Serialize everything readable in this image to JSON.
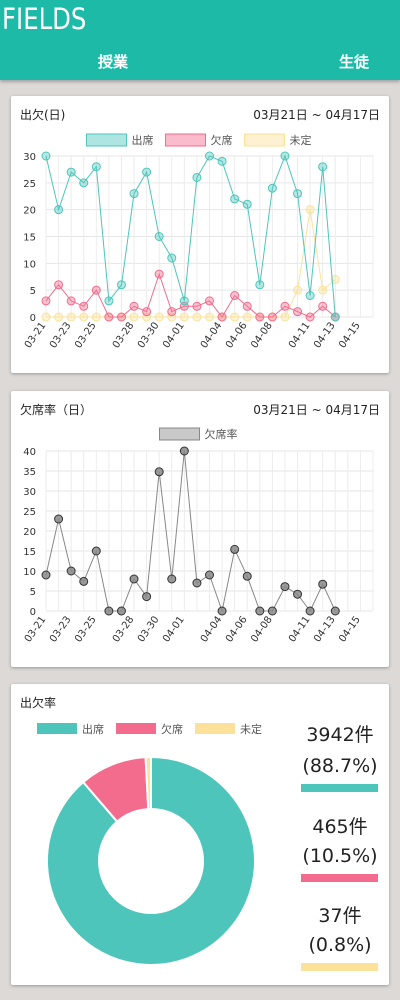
{
  "header": {
    "app_title": "FIELDS",
    "tabs": [
      "授業",
      "生徒"
    ]
  },
  "colors": {
    "header": "#1dbaa7",
    "present": "#4ec5bb",
    "absent": "#f36b8d",
    "undecided": "#fbe19a",
    "rate": "#888888"
  },
  "attendance_card": {
    "title": "出欠(日)",
    "date_range": "03月21日 ~ 04月17日"
  },
  "rate_card": {
    "title": "欠席率（日）",
    "date_range": "03月21日 ~ 04月17日"
  },
  "summary_card": {
    "title": "出欠率",
    "stats": [
      {
        "count": "3942件",
        "percent": "(88.7%)"
      },
      {
        "count": "465件",
        "percent": "(10.5%)"
      },
      {
        "count": "37件",
        "percent": "(0.8%)"
      }
    ]
  },
  "chart_data": [
    {
      "type": "line",
      "title": "",
      "x": [
        "03-21",
        "03-22",
        "03-23",
        "03-24",
        "03-25",
        "03-26",
        "03-27",
        "03-28",
        "03-29",
        "03-30",
        "03-31",
        "04-01",
        "04-02",
        "04-03",
        "04-04",
        "04-05",
        "04-06",
        "04-07",
        "04-08",
        "04-09",
        "04-10",
        "04-11",
        "04-12",
        "04-13",
        "04-14",
        "04-15",
        "04-16"
      ],
      "xticks": [
        "03-21",
        "03-23",
        "03-25",
        "03-28",
        "03-30",
        "04-01",
        "04-04",
        "04-06",
        "04-08",
        "04-11",
        "04-13",
        "04-15"
      ],
      "ylim": [
        0,
        30
      ],
      "yticks": [
        0,
        5,
        10,
        15,
        20,
        25,
        30
      ],
      "grid": true,
      "legend": "top-center",
      "series": [
        {
          "name": "出席",
          "values": [
            30,
            20,
            27,
            25,
            28,
            3,
            6,
            23,
            27,
            15,
            11,
            3,
            26,
            30,
            29,
            22,
            21,
            6,
            24,
            30,
            23,
            4,
            28,
            0
          ]
        },
        {
          "name": "欠席",
          "values": [
            3,
            6,
            3,
            2,
            5,
            0,
            0,
            2,
            1,
            8,
            1,
            2,
            2,
            3,
            0,
            4,
            2,
            0,
            0,
            2,
            1,
            0,
            2,
            0
          ]
        },
        {
          "name": "未定",
          "values": [
            0,
            0,
            0,
            0,
            0,
            0,
            0,
            0,
            0,
            0,
            0,
            0,
            0,
            0,
            0,
            0,
            0,
            0,
            0,
            0,
            5,
            20,
            5,
            7
          ]
        }
      ]
    },
    {
      "type": "line",
      "title": "",
      "x": [
        "03-21",
        "03-22",
        "03-23",
        "03-24",
        "03-25",
        "03-26",
        "03-27",
        "03-28",
        "03-29",
        "03-30",
        "03-31",
        "04-01",
        "04-02",
        "04-03",
        "04-04",
        "04-05",
        "04-06",
        "04-07",
        "04-08",
        "04-09",
        "04-10",
        "04-11",
        "04-12",
        "04-13",
        "04-14",
        "04-15",
        "04-16"
      ],
      "xticks": [
        "03-21",
        "03-23",
        "03-25",
        "03-28",
        "03-30",
        "04-01",
        "04-04",
        "04-06",
        "04-08",
        "04-11",
        "04-13",
        "04-15"
      ],
      "ylim": [
        0,
        40
      ],
      "yticks": [
        0,
        5,
        10,
        15,
        20,
        25,
        30,
        35,
        40
      ],
      "grid": true,
      "legend": "top-center",
      "series": [
        {
          "name": "欠席率",
          "values": [
            9,
            23,
            10,
            7.4,
            15,
            0,
            0,
            8,
            3.6,
            34.8,
            8,
            40,
            7,
            9,
            0,
            15.4,
            8.7,
            0,
            0,
            6.1,
            4.2,
            0,
            6.7,
            0
          ]
        }
      ]
    },
    {
      "type": "pie",
      "title": "",
      "legend": "top",
      "categories": [
        "出席",
        "欠席",
        "未定"
      ],
      "values": [
        3942,
        465,
        37
      ],
      "percent": [
        88.7,
        10.5,
        0.8
      ]
    }
  ]
}
